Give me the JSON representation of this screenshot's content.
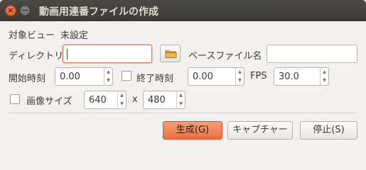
{
  "window": {
    "title": "動画用連番ファイルの作成"
  },
  "target": {
    "label": "対象ビュー",
    "value": "未設定"
  },
  "directory": {
    "label": "ディレクトリ",
    "value": ""
  },
  "basename": {
    "label": "ベースファイル名",
    "value": ""
  },
  "start_time": {
    "label": "開始時刻",
    "value": "0.00"
  },
  "end_time": {
    "label": "終了時刻",
    "value": "0.00",
    "checked": false
  },
  "fps": {
    "label": "FPS",
    "value": "30.0"
  },
  "image_size": {
    "label": "画像サイズ",
    "checked": false,
    "width": "640",
    "separator": "x",
    "height": "480"
  },
  "buttons": {
    "generate": "生成(G)",
    "capture": "キャプチャー",
    "stop": "停止(S)"
  }
}
